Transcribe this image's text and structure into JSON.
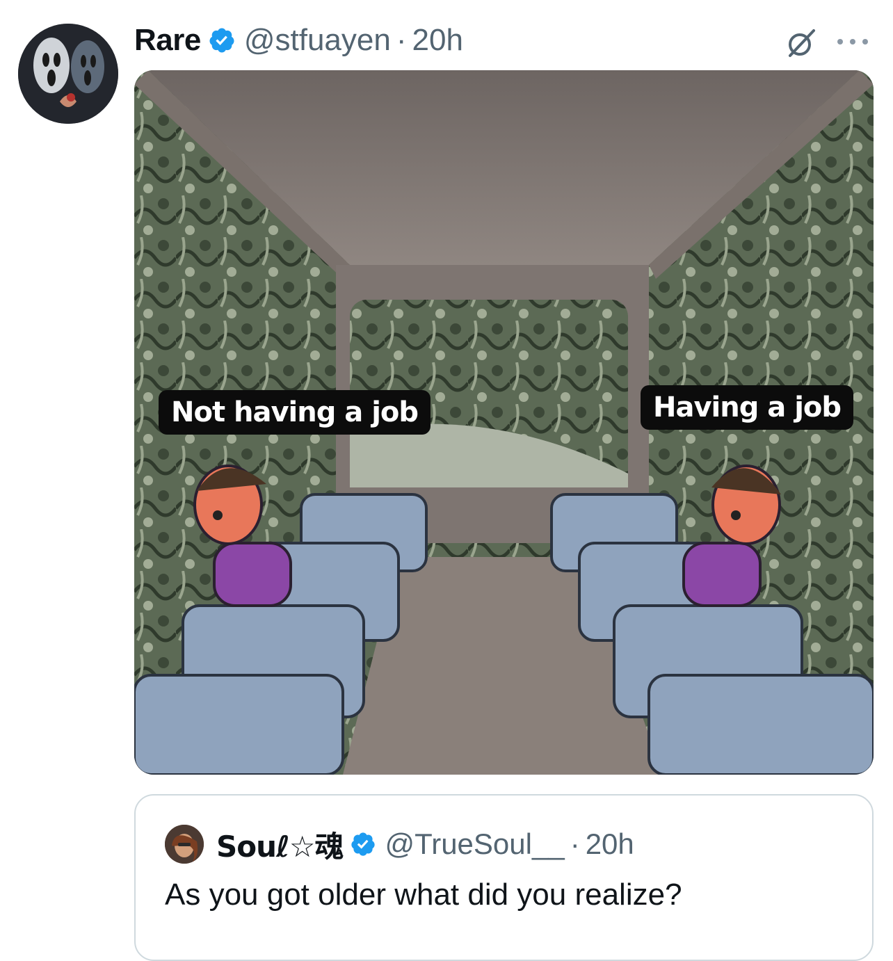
{
  "tweet": {
    "author_name": "Rare",
    "author_handle": "@stfuayen",
    "separator": "·",
    "time": "20h",
    "image": {
      "left_label": "Not having a job",
      "right_label": "Having a job"
    }
  },
  "quoted_tweet": {
    "author_name": "Souℓ☆魂",
    "author_handle": "@TrueSoul__",
    "separator": "·",
    "time": "20h",
    "text": "As you got older what did you realize?"
  },
  "icons": {
    "verified": "verified-badge-icon",
    "grok": "grok-icon",
    "more": "more-options-icon"
  },
  "colors": {
    "verified_blue": "#1d9bf0",
    "secondary_text": "#536471",
    "primary_text": "#0f1419",
    "border": "#cfd9de"
  }
}
